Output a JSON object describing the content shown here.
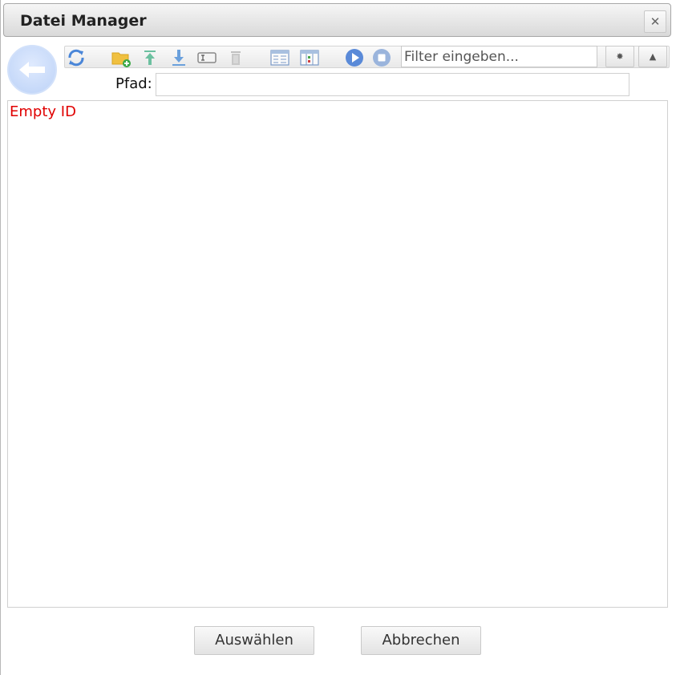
{
  "window": {
    "title": "Datei Manager",
    "close_icon": "close-icon"
  },
  "toolbar": {
    "buttons": [
      {
        "name": "refresh-icon",
        "color": "#4a86d8"
      },
      {
        "name": "new-folder-icon",
        "color": "#f0c040"
      },
      {
        "name": "upload-icon",
        "color": "#6cc0a0"
      },
      {
        "name": "download-icon",
        "color": "#6aa0dc"
      },
      {
        "name": "rename-icon",
        "color": "#888888"
      },
      {
        "name": "delete-icon",
        "color": "#c0c0c0"
      },
      {
        "name": "list-view-icon",
        "color": "#7a9ac8"
      },
      {
        "name": "table-view-icon",
        "color": "#7a9ac8"
      },
      {
        "name": "play-icon",
        "color": "#5a8ad8"
      },
      {
        "name": "stop-icon",
        "color": "#9ab4dc"
      }
    ],
    "filter_placeholder": "Filter eingeben...",
    "settings_icon": "gear-icon",
    "warning_icon": "warning-icon"
  },
  "back_icon": "arrow-left-icon",
  "path": {
    "label": "Pfad:",
    "value": ""
  },
  "content": {
    "message": "Empty ID",
    "message_color": "#e00000"
  },
  "footer": {
    "select_label": "Auswählen",
    "cancel_label": "Abbrechen"
  }
}
